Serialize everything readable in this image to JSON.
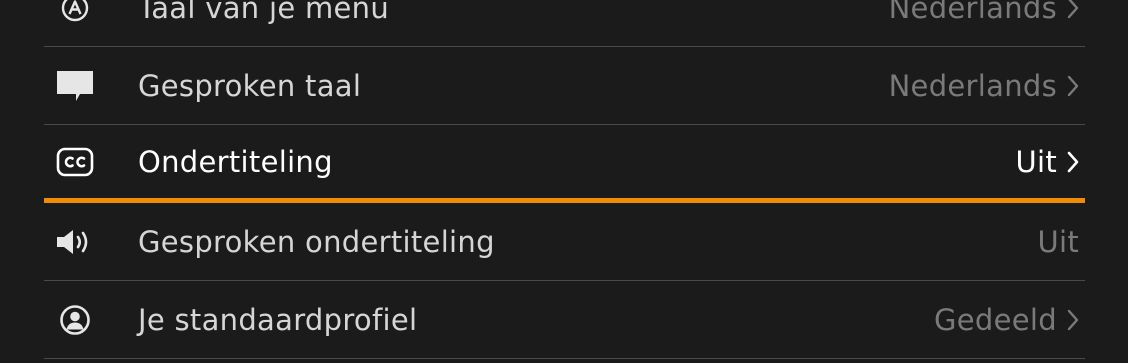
{
  "menu": {
    "items": [
      {
        "label": "Taal van je menu",
        "value": "Nederlands",
        "icon": "letter-a-circle-icon",
        "chevron": true
      },
      {
        "label": "Gesproken taal",
        "value": "Nederlands",
        "icon": "speech-bubble-icon",
        "chevron": true
      },
      {
        "label": "Ondertiteling",
        "value": "Uit",
        "icon": "cc-icon",
        "chevron": true,
        "selected": true
      },
      {
        "label": "Gesproken ondertiteling",
        "value": "Uit",
        "icon": "speaker-icon",
        "chevron": false
      },
      {
        "label": "Je standaardprofiel",
        "value": "Gedeeld",
        "icon": "profile-icon",
        "chevron": true
      }
    ]
  },
  "colors": {
    "background": "#1b1b1b",
    "selection_underline": "#f08c00",
    "label_text": "#d6d6d6",
    "value_text": "#7a7a7a",
    "selected_text": "#ffffff",
    "divider": "#4a4a4a"
  }
}
